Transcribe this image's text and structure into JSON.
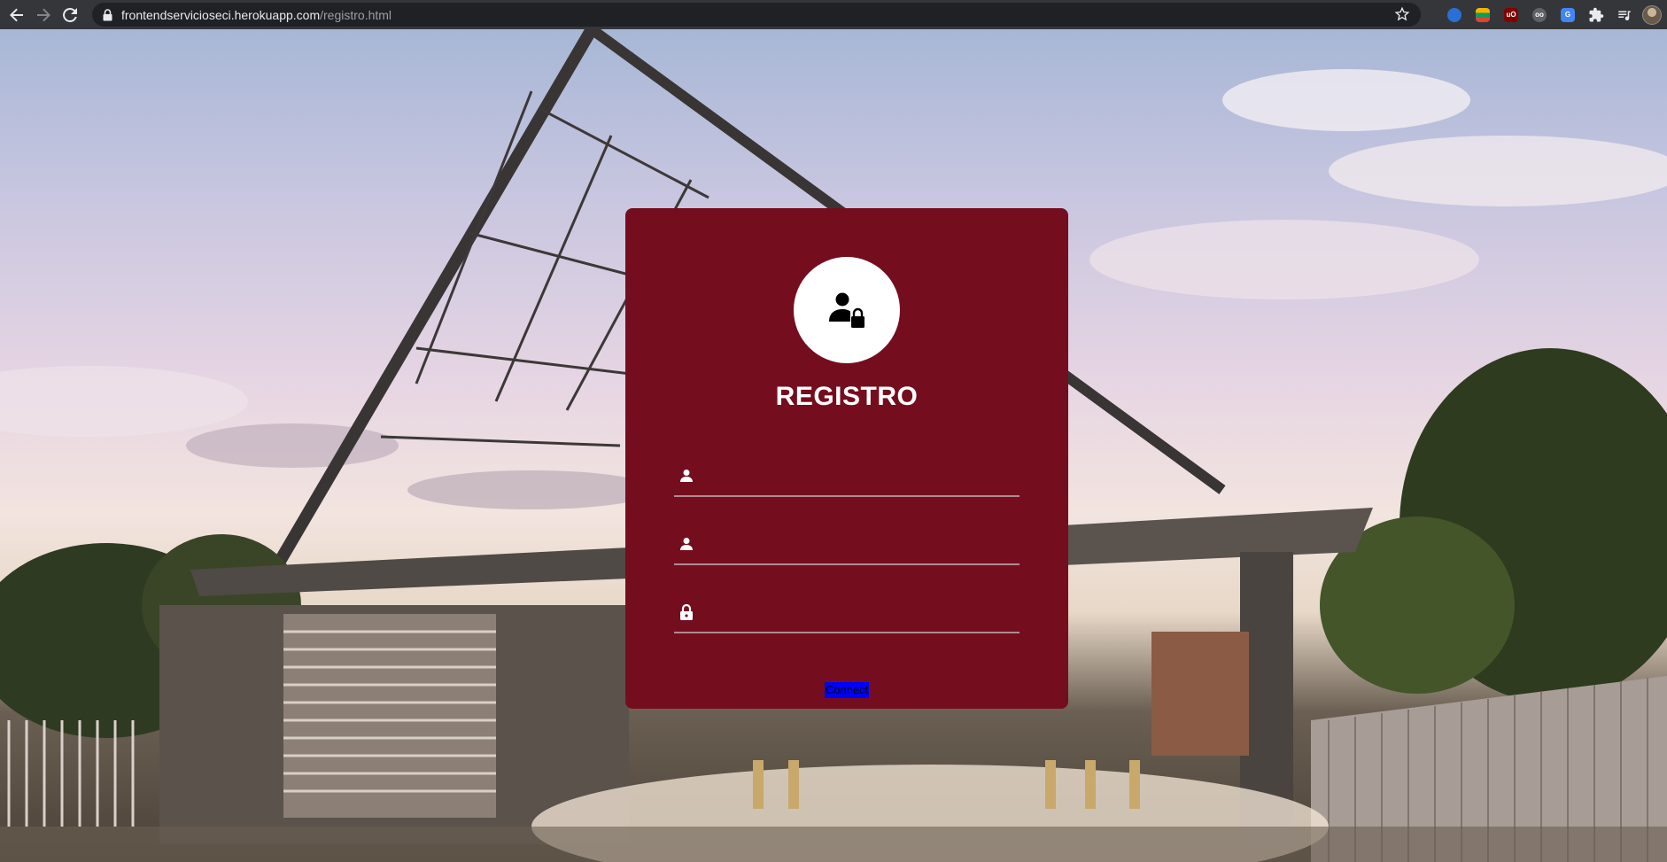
{
  "browser": {
    "url_host": "frontendservicioseci.herokuapp.com",
    "url_path": "/registro.html",
    "icons": [
      "back-arrow-icon",
      "forward-arrow-icon",
      "reload-icon",
      "lock-icon",
      "star-icon",
      "extensions-icon",
      "reading-list-icon"
    ]
  },
  "card": {
    "title": "REGISTRO",
    "avatar_icon": "user-lock-icon",
    "fields": [
      {
        "icon": "user-icon",
        "type": "text",
        "value": "",
        "placeholder": ""
      },
      {
        "icon": "user-icon",
        "type": "text",
        "value": "",
        "placeholder": ""
      },
      {
        "icon": "lock-icon",
        "type": "password",
        "value": "",
        "placeholder": ""
      }
    ],
    "submit_label": "Connect"
  },
  "colors": {
    "card_bg": "#740e1f",
    "field_line": "#b08a91",
    "submit_bg": "#0000ff"
  }
}
